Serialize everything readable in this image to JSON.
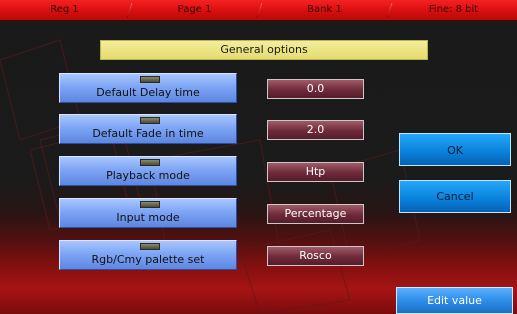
{
  "status_bar": {
    "items": [
      "Reg 1",
      "Page 1",
      "Bank 1",
      "Fine: 8 bit"
    ]
  },
  "header": {
    "title": "General options"
  },
  "options": [
    {
      "label": "Default Delay time",
      "value": "0.0"
    },
    {
      "label": "Default Fade in time",
      "value": "2.0"
    },
    {
      "label": "Playback mode",
      "value": "Htp"
    },
    {
      "label": "Input mode",
      "value": "Percentage"
    },
    {
      "label": "Rgb/Cmy palette set",
      "value": "Rosco"
    }
  ],
  "actions": {
    "ok_label": "OK",
    "cancel_label": "Cancel",
    "edit_value_label": "Edit value"
  },
  "colors": {
    "status_bar": "#e61414",
    "header_bg": "#ece57e",
    "option_button": "#7ea5f5",
    "value_box": "#6e2a3a",
    "side_button": "#0b83dd"
  }
}
